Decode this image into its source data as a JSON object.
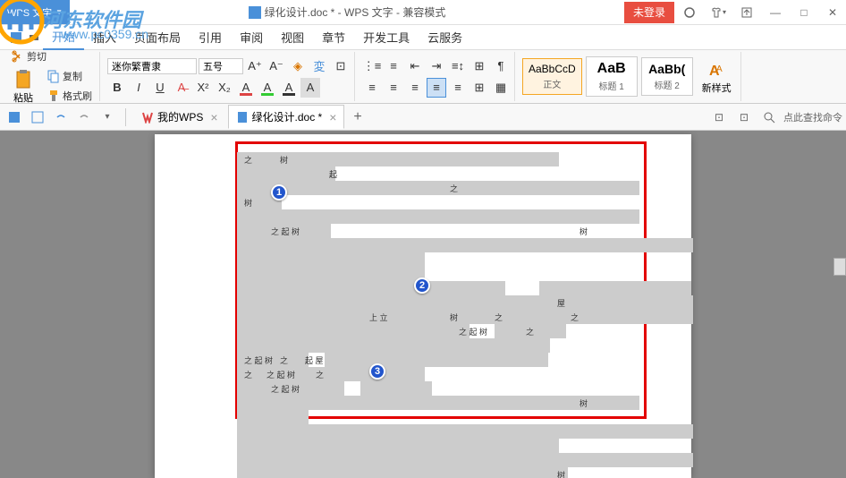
{
  "app": {
    "name": "WPS 文字",
    "title_doc": "绿化设计.doc *",
    "title_app": "WPS 文字",
    "title_mode": "兼容模式",
    "login": "未登录"
  },
  "watermark": {
    "text": "河东软件园",
    "url": "www.pc0359.cn"
  },
  "menu": {
    "items": [
      "开始",
      "插入",
      "页面布局",
      "引用",
      "审阅",
      "视图",
      "章节",
      "开发工具",
      "云服务"
    ],
    "active_index": 0
  },
  "ribbon": {
    "cut": "剪切",
    "paste": "粘贴",
    "copy": "复制",
    "format_painter": "格式刷",
    "font_name": "迷你繁曹隶",
    "font_size": "五号",
    "bold": "B",
    "italic": "I",
    "underline": "U",
    "strike": "A",
    "superscript": "X²",
    "subscript": "X₂",
    "font_color": "A",
    "highlight": "A",
    "char_shade": "A",
    "styles": [
      {
        "preview": "AaBbCcD",
        "name": "正文"
      },
      {
        "preview": "AaB",
        "name": "标题 1"
      },
      {
        "preview": "AaBb(",
        "name": "标题 2"
      }
    ],
    "new_style": "新样式"
  },
  "tabs": {
    "my_wps": "我的WPS",
    "doc_name": "绿化设计.doc *",
    "search_hint": "点此查找命令"
  },
  "document": {
    "markers": [
      "①",
      "②",
      "③"
    ],
    "num1": "1",
    "num2": "2",
    "num3": "3",
    "fragments": [
      "树",
      "之",
      "起",
      "上 立",
      "树",
      "屋",
      "之 起 树",
      "之",
      "树",
      "树",
      "树",
      "起 屋",
      "起",
      "树"
    ]
  }
}
